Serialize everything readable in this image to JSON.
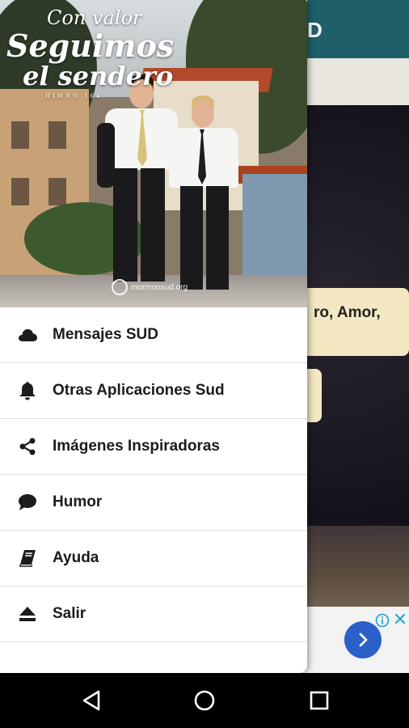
{
  "background_app": {
    "title_fragment": "D",
    "card_text_fragment": "ro, Amor,",
    "colors": {
      "app_bar": "#1f5f6a",
      "card": "#f4e8c3"
    }
  },
  "drawer": {
    "header": {
      "title_line1": "Con valor",
      "title_line2": "Seguimos",
      "title_line3": "el sendero",
      "title_small": "HIMNO 164",
      "watermark": "mormonsud.org"
    },
    "items": [
      {
        "label": "Mensajes SUD",
        "icon": "cloud-icon"
      },
      {
        "label": "Otras Aplicaciones Sud",
        "icon": "bell-icon"
      },
      {
        "label": "Imágenes Inspiradoras",
        "icon": "share-icon"
      },
      {
        "label": "Humor",
        "icon": "chat-bubble-icon"
      },
      {
        "label": "Ayuda",
        "icon": "book-icon"
      },
      {
        "label": "Salir",
        "icon": "eject-icon"
      }
    ]
  },
  "ad": {
    "next_icon": "chevron-right-icon",
    "info_icon": "info-icon",
    "close_icon": "close-icon"
  },
  "navbar": {
    "back_icon": "back-triangle-icon",
    "home_icon": "home-circle-icon",
    "recents_icon": "recents-square-icon"
  }
}
